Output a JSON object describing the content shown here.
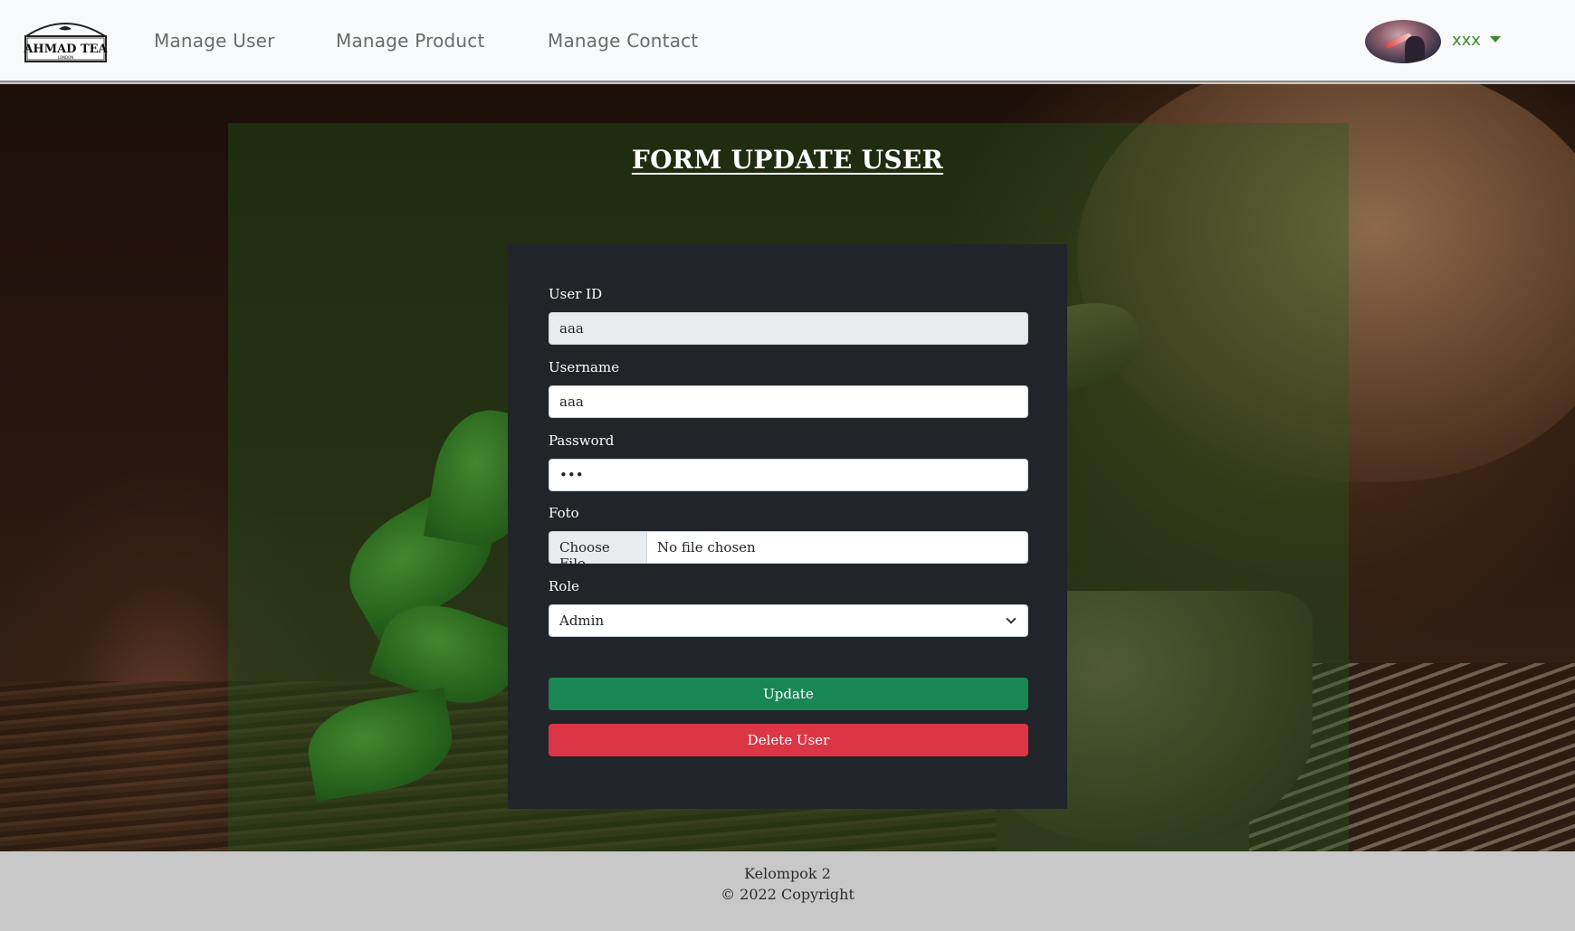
{
  "brand": {
    "logo_text": "AHMAD TEA",
    "logo_subtext": "LONDON"
  },
  "nav": {
    "items": [
      {
        "label": "Manage User"
      },
      {
        "label": "Manage Product"
      },
      {
        "label": "Manage Contact"
      }
    ],
    "user": {
      "name": "xxx"
    }
  },
  "form": {
    "title": "FORM UPDATE USER",
    "fields": {
      "user_id": {
        "label": "User ID",
        "value": "aaa"
      },
      "username": {
        "label": "Username",
        "value": "aaa"
      },
      "password": {
        "label": "Password",
        "value": "•••"
      },
      "foto": {
        "label": "Foto",
        "button": "Choose File",
        "status": "No file chosen"
      },
      "role": {
        "label": "Role",
        "value": "Admin"
      }
    },
    "update_label": "Update",
    "delete_label": "Delete User"
  },
  "footer": {
    "line1": "Kelompok 2",
    "line2": "© 2022 Copyright"
  },
  "colors": {
    "update": "#198754",
    "delete": "#dc3545",
    "user_accent": "#3f8a2e",
    "card": "#212529"
  }
}
